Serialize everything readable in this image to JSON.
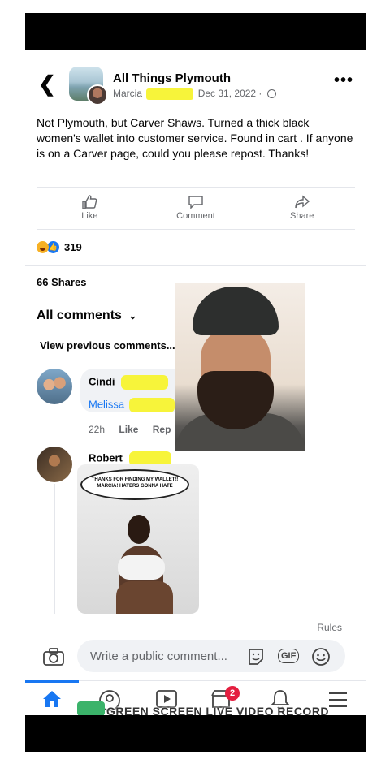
{
  "header": {
    "group_name": "All Things Plymouth",
    "author": "Marcia",
    "date": "Dec 31, 2022 ·"
  },
  "post": {
    "text": "Not Plymouth,  but Carver Shaws. Turned a thick black women's wallet into customer service.  Found in cart . If anyone is on a Carver page, could you please repost. Thanks!"
  },
  "actions": {
    "like": "Like",
    "comment": "Comment",
    "share": "Share"
  },
  "reactions": {
    "count": "319",
    "icons": [
      "haha-icon",
      "like-icon"
    ]
  },
  "shares": "66 Shares",
  "comments": {
    "filter_label": "All comments",
    "view_previous": "View previous comments...",
    "items": [
      {
        "name": "Cindi",
        "text": "Melissa",
        "time": "22h",
        "like": "Like",
        "reply": "Rep"
      },
      {
        "name": "Robert",
        "meme_text": "THANKS FOR FINDING MY WALLET!! MARCIA! HATERS GONNA HATE"
      }
    ]
  },
  "composer": {
    "rules": "Rules",
    "placeholder": "Write a public comment...",
    "gif": "GIF"
  },
  "tabbar": {
    "badge_count": "2",
    "watermark": "GREEN SCREEN LIVE VIDEO RECORD"
  },
  "colors": {
    "brand_blue": "#1877f2",
    "highlight": "#f7f43a",
    "badge_red": "#e41e3f"
  }
}
